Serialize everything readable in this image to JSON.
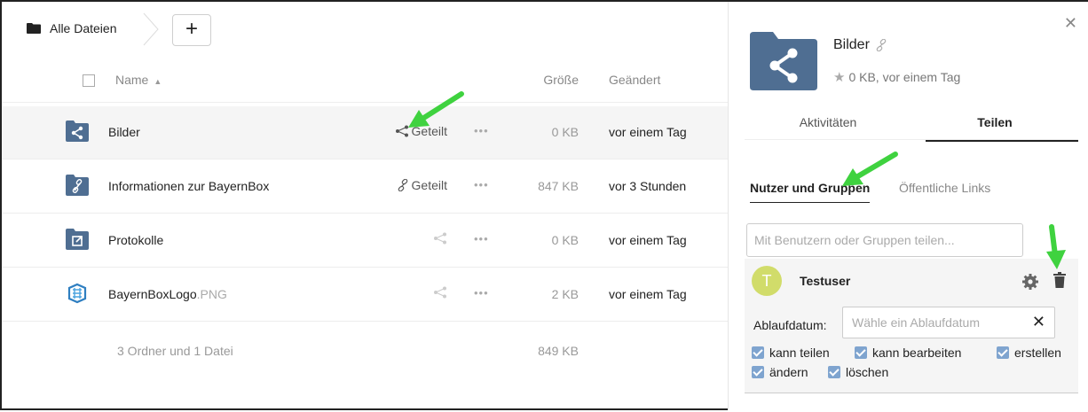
{
  "breadcrumb": {
    "label": "Alle Dateien"
  },
  "toolbar": {
    "add_label": "+"
  },
  "table": {
    "headers": {
      "name": "Name",
      "size": "Größe",
      "modified": "Geändert"
    },
    "rows": [
      {
        "icon": "shared-folder-icon",
        "name": "Bilder",
        "ext": "",
        "share": "Geteilt",
        "share_icon": "share-icon",
        "size": "0 KB",
        "modified": "vor einem Tag",
        "selected": true
      },
      {
        "icon": "link-folder-icon",
        "name": "Informationen zur BayernBox",
        "ext": "",
        "share": "Geteilt",
        "share_icon": "link-icon",
        "size": "847 KB",
        "modified": "vor 3 Stunden"
      },
      {
        "icon": "external-folder-icon",
        "name": "Protokolle",
        "ext": "",
        "share": "",
        "share_icon": "share-icon",
        "size": "0 KB",
        "modified": "vor einem Tag"
      },
      {
        "icon": "image-file-icon",
        "name": "BayernBoxLogo",
        "ext": ".PNG",
        "share": "",
        "share_icon": "share-icon",
        "size": "2 KB",
        "modified": "vor einem Tag"
      }
    ],
    "summary": {
      "text": "3 Ordner und 1 Datei",
      "size": "849 KB"
    }
  },
  "sidebar": {
    "title": "Bilder",
    "meta": "0 KB, vor einem Tag",
    "tabs": [
      "Aktivitäten",
      "Teilen"
    ],
    "active_tab": "Teilen",
    "subtabs": [
      "Nutzer und Gruppen",
      "Öffentliche Links"
    ],
    "share_placeholder": "Mit Benutzern oder Gruppen teilen...",
    "share_entry": {
      "avatar_letter": "T",
      "user": "Testuser",
      "expiry_label": "Ablaufdatum:",
      "expiry_placeholder": "Wähle ein Ablaufdatum",
      "expiry_clear": "✕",
      "permissions": [
        "kann teilen",
        "kann bearbeiten",
        "erstellen",
        "ändern",
        "löschen"
      ]
    }
  },
  "colors": {
    "folder": "#4f6e92",
    "accent_checkbox": "#7fa4cf",
    "arrow": "#3fd23f",
    "avatar": "#d1dc6a"
  }
}
